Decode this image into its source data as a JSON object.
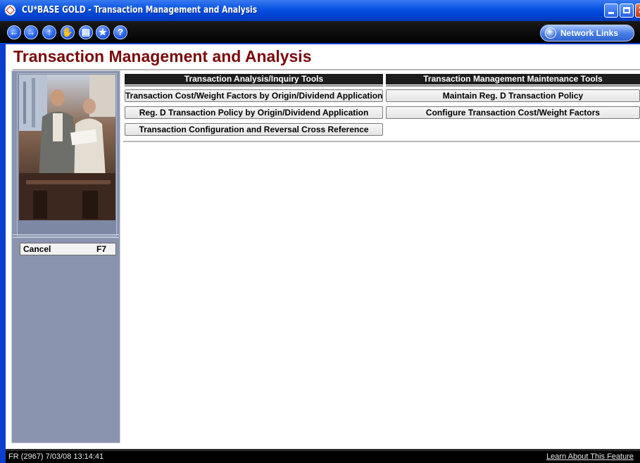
{
  "window": {
    "title": "CU*BASE GOLD - Transaction Management and Analysis"
  },
  "toolbar": {
    "nav_icons": [
      "back-icon",
      "forward-icon",
      "up-icon",
      "hand-icon",
      "print-icon",
      "favorites-icon",
      "help-icon"
    ],
    "network_links_label": "Network Links"
  },
  "page": {
    "title": "Transaction Management and Analysis"
  },
  "sidebar": {
    "cancel_label": "Cancel",
    "cancel_key": "F7"
  },
  "analysis_tools": {
    "header": "Transaction Analysis/Inquiry Tools",
    "buttons": [
      "Transaction Cost/Weight Factors by Origin/Dividend Application",
      "Reg. D Transaction Policy by Origin/Dividend Application",
      "Transaction Configuration and Reversal Cross Reference"
    ]
  },
  "maintenance_tools": {
    "header": "Transaction Management Maintenance Tools",
    "buttons": [
      "Maintain Reg. D Transaction Policy",
      "Configure Transaction Cost/Weight Factors"
    ]
  },
  "status": {
    "left": "FR (2967) 7/03/08 13:14:41",
    "right_link": "Learn About This Feature"
  },
  "colors": {
    "title_red": "#7a0a0a",
    "titlebar_blue": "#0a55e2",
    "sidebar_gray": "#8a94ae"
  }
}
